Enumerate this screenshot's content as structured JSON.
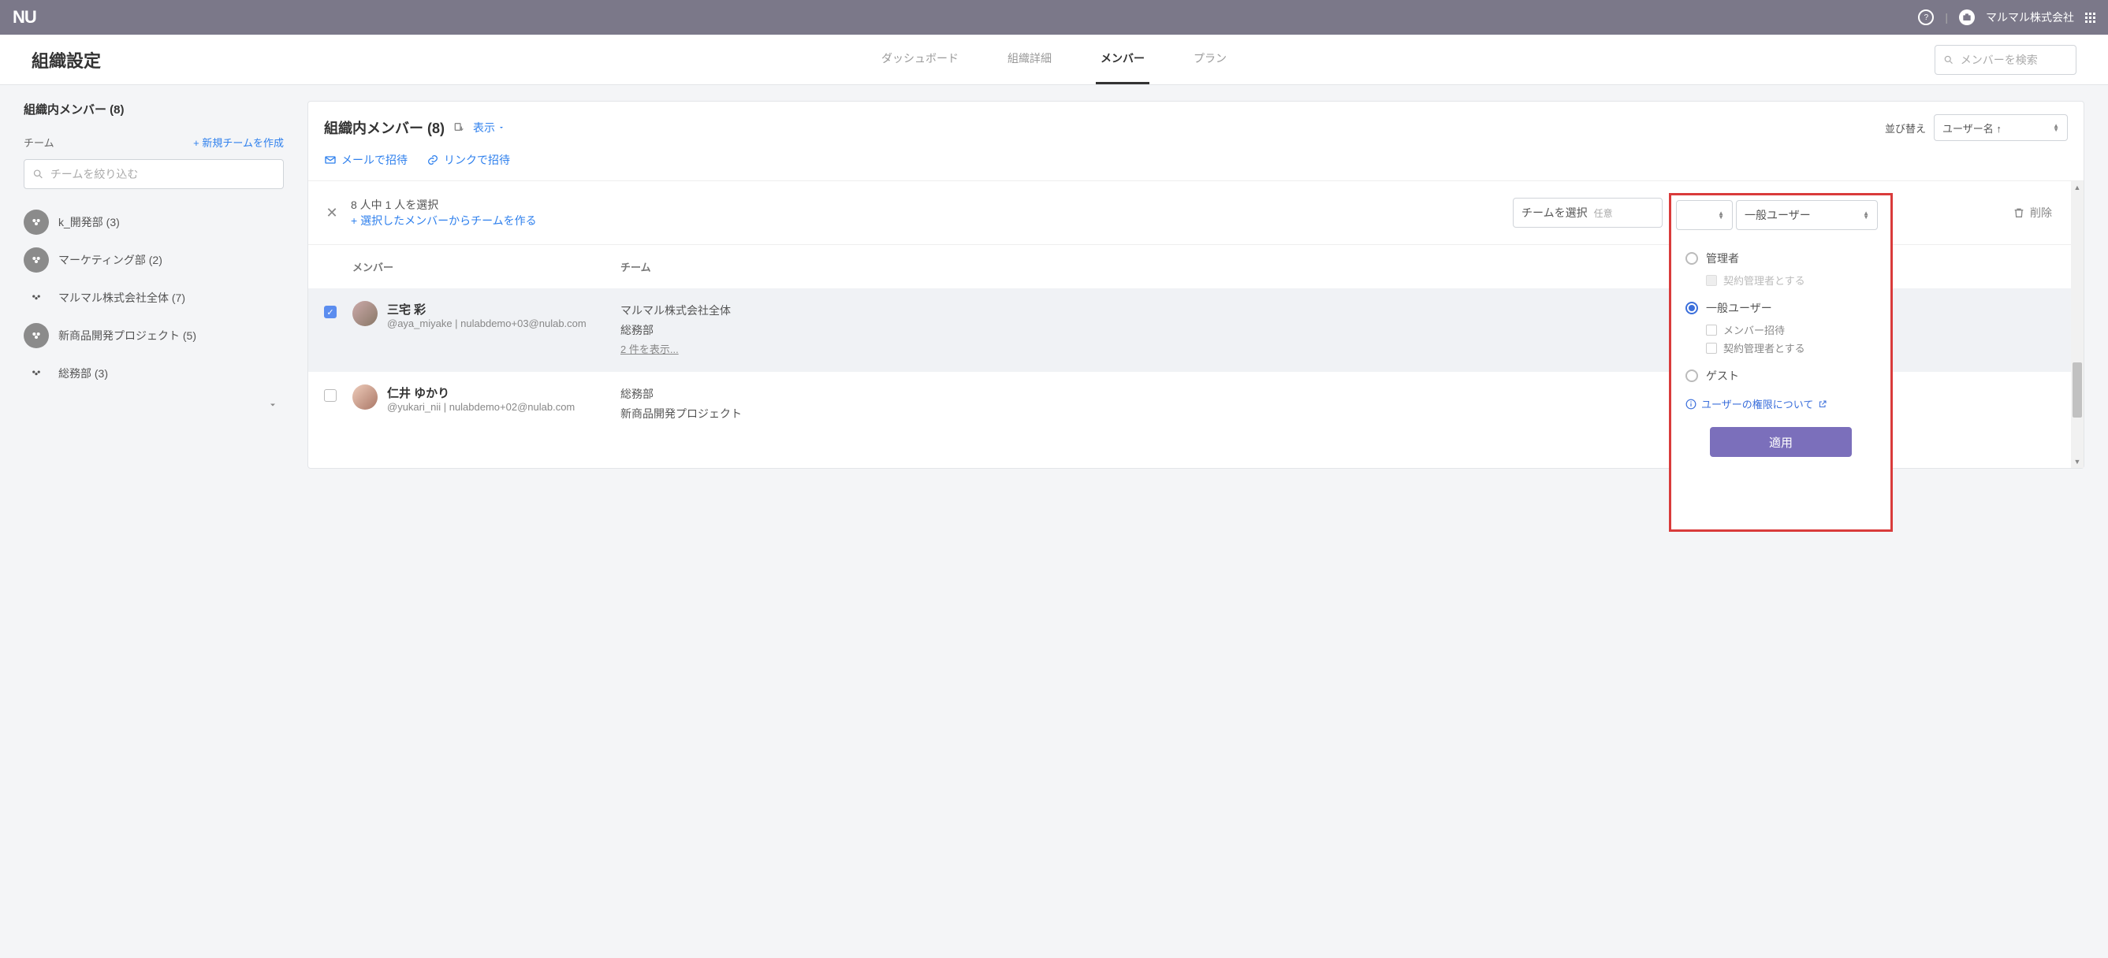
{
  "appbar": {
    "logo": "NU",
    "help": "?",
    "org_name": "マルマル株式会社"
  },
  "page": {
    "title": "組織設定",
    "tabs": {
      "dashboard": "ダッシュボード",
      "details": "組織詳細",
      "members": "メンバー",
      "plan": "プラン"
    },
    "search_placeholder": "メンバーを検索"
  },
  "sidebar": {
    "title": "組織内メンバー (8)",
    "team_section": "チーム",
    "add_team": "+ 新規チームを作成",
    "filter_placeholder": "チームを絞り込む",
    "teams": [
      {
        "label": "k_開発部 (3)"
      },
      {
        "label": "マーケティング部 (2)"
      },
      {
        "label": "マルマル株式会社全体 (7)"
      },
      {
        "label": "新商品開発プロジェクト (5)"
      },
      {
        "label": "総務部 (3)"
      }
    ]
  },
  "main": {
    "title": "組織内メンバー (8)",
    "show": "表示",
    "sort_label": "並び替え",
    "sort_value": "ユーザー名 ↑",
    "invite_mail": "メールで招待",
    "invite_link": "リンクで招待",
    "selection": {
      "count": "8 人中 1 人を選択",
      "make_team": "+ 選択したメンバーからチームを作る",
      "team_select": "チームを選択",
      "team_optional": "任意",
      "role_value": "一般ユーザー",
      "delete": "削除"
    },
    "columns": {
      "member": "メンバー",
      "team": "チーム"
    },
    "rows": [
      {
        "selected": true,
        "name": "三宅 彩",
        "sub": "@aya_miyake | nulabdemo+03@nulab.com",
        "teams": [
          "マルマル株式会社全体",
          "総務部"
        ],
        "more": "2 件を表示..."
      },
      {
        "selected": false,
        "name": "仁井 ゆかり",
        "sub": "@yukari_nii | nulabdemo+02@nulab.com",
        "teams": [
          "総務部",
          "新商品開発プロジェクト"
        ]
      }
    ],
    "popup": {
      "admin": "管理者",
      "admin_sub": "契約管理者とする",
      "general": "一般ユーザー",
      "general_sub1": "メンバー招待",
      "general_sub2": "契約管理者とする",
      "guest": "ゲスト",
      "info": "ユーザーの権限について",
      "apply": "適用"
    }
  }
}
